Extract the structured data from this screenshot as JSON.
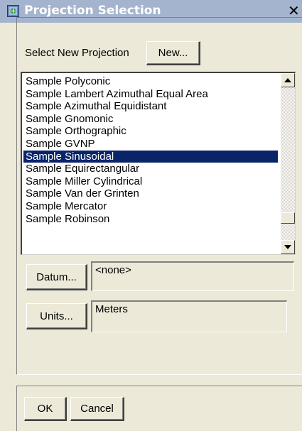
{
  "window": {
    "title": "Projection Selection",
    "close_glyph": "✕",
    "icon": "dialog-icon"
  },
  "header": {
    "prompt": "Select New Projection",
    "new_label": "New..."
  },
  "projection_list": {
    "items": [
      "Sample Polyconic",
      "Sample Lambert Azimuthal Equal Area",
      "Sample Azimuthal Equidistant",
      "Sample Gnomonic",
      "Sample Orthographic",
      "Sample GVNP",
      "Sample Sinusoidal",
      "Sample Equirectangular",
      "Sample Miller Cylindrical",
      "Sample Van der Grinten",
      "Sample Mercator",
      "Sample Robinson"
    ],
    "selected_index": 6
  },
  "datum": {
    "label": "Datum...",
    "value": "<none>"
  },
  "units": {
    "label": "Units...",
    "value": "Meters"
  },
  "footer": {
    "ok_label": "OK",
    "cancel_label": "Cancel"
  },
  "colors": {
    "selection": "#0a246a",
    "titlebar": "#a4b4ce",
    "dialog_bg": "#ece9d8"
  }
}
